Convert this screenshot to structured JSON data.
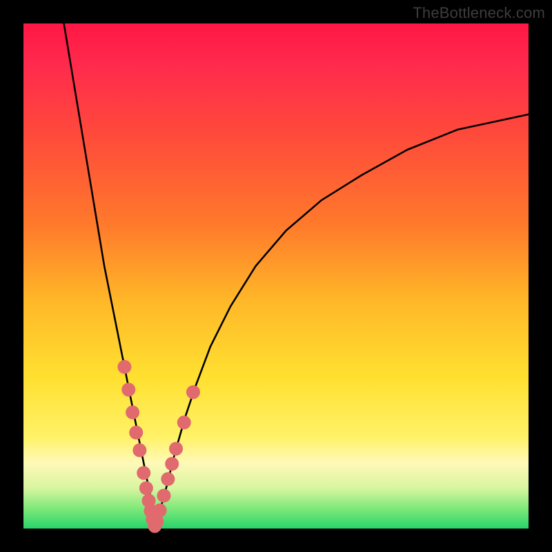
{
  "watermark": "TheBottleneck.com",
  "chart_data": {
    "type": "line",
    "title": "",
    "xlabel": "",
    "ylabel": "",
    "xlim": [
      0,
      100
    ],
    "ylim": [
      0,
      100
    ],
    "grid": false,
    "legend": false,
    "notes": "V-shaped bottleneck curve on rainbow background; no axes shown",
    "series": [
      {
        "name": "left-branch",
        "x": [
          8,
          10,
          12,
          14,
          16,
          18,
          19,
          20,
          21,
          22,
          23,
          24,
          25,
          25.5,
          26
        ],
        "values": [
          100,
          88,
          76,
          64,
          52,
          42,
          37,
          32,
          27,
          22,
          17,
          12,
          7,
          3.5,
          0
        ]
      },
      {
        "name": "right-branch",
        "x": [
          26,
          27,
          28,
          29,
          30,
          32,
          34,
          37,
          41,
          46,
          52,
          59,
          67,
          76,
          86,
          100
        ],
        "values": [
          0,
          3.5,
          7,
          11,
          15,
          22,
          28,
          36,
          44,
          52,
          59,
          65,
          70,
          75,
          79,
          82
        ]
      }
    ],
    "points": {
      "name": "highlight-dots",
      "color": "#e06a6e",
      "radius_px": 10,
      "x": [
        20.0,
        20.8,
        21.6,
        22.3,
        23.0,
        23.8,
        24.3,
        24.8,
        25.2,
        25.6,
        26.0,
        26.4,
        27.0,
        27.8,
        28.6,
        29.4,
        30.2,
        31.8,
        33.6
      ],
      "values": [
        32.0,
        27.5,
        23.0,
        19.0,
        15.5,
        11.0,
        8.0,
        5.5,
        3.5,
        1.8,
        0.5,
        1.4,
        3.6,
        6.5,
        9.8,
        12.8,
        15.8,
        21.0,
        27.0
      ]
    },
    "colors": {
      "curve": "#000000",
      "dots": "#e06a6e",
      "background_top": "#ff1744",
      "background_bottom": "#29d36b"
    }
  }
}
